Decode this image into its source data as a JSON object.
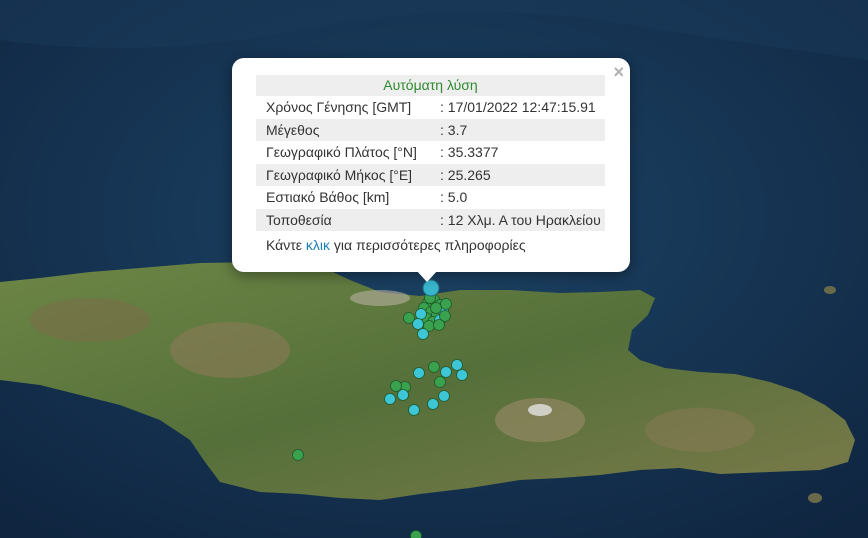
{
  "popup": {
    "title": "Αυτόματη λύση",
    "close_symbol": "×",
    "rows": [
      {
        "label": "Χρόνος Γένησης [GMT]",
        "value": ": 17/01/2022 12:47:15.91"
      },
      {
        "label": "Μέγεθος",
        "value": ": 3.7"
      },
      {
        "label": "Γεωγραφικό Πλάτος [°N]",
        "value": ": 35.3377"
      },
      {
        "label": "Γεωγραφικό Μήκος [°E]",
        "value": ": 25.265"
      },
      {
        "label": "Εστιακό Βάθος [km]",
        "value": ": 5.0"
      },
      {
        "label": "Τοποθεσία",
        "value": ": 12 Χλμ. Α του Ηρακλείου"
      }
    ],
    "more_prefix": "Κάντε ",
    "more_link": "κλικ",
    "more_suffix": " για περισσότερες πληροφορίες"
  },
  "colors": {
    "sea": "#15304a",
    "land": "#5d7a3a",
    "marker_green": "#3aa24e",
    "marker_cyan": "#3cc6d6",
    "selected_marker": "#38b6cc"
  },
  "icons": {
    "close": "close-icon",
    "markers": "earthquake-marker-icon"
  }
}
